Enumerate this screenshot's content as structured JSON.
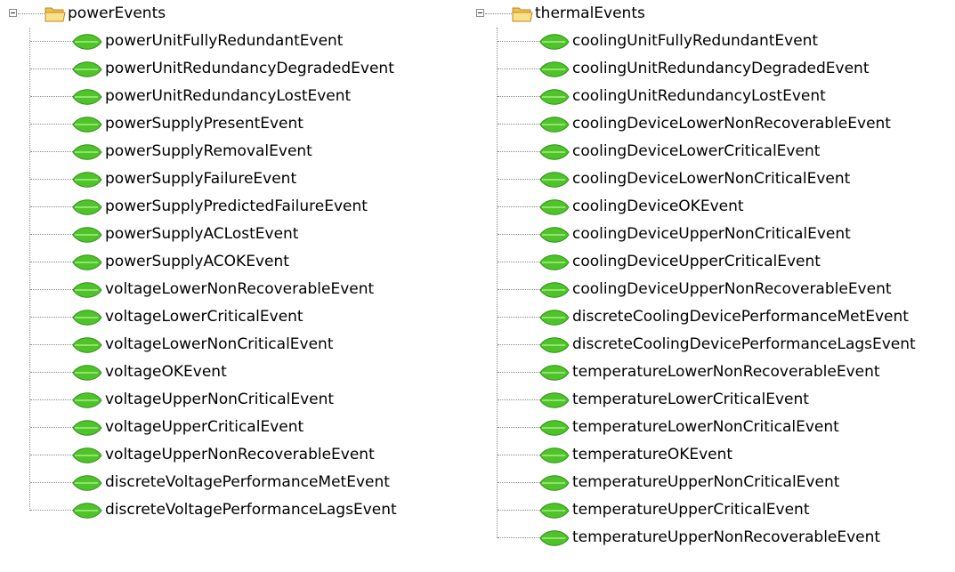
{
  "trees": [
    {
      "root": {
        "label": "powerEvents",
        "icon": "folder-icon",
        "expanded": true
      },
      "items": [
        "powerUnitFullyRedundantEvent",
        "powerUnitRedundancyDegradedEvent",
        "powerUnitRedundancyLostEvent",
        "powerSupplyPresentEvent",
        "powerSupplyRemovalEvent",
        "powerSupplyFailureEvent",
        "powerSupplyPredictedFailureEvent",
        "powerSupplyACLostEvent",
        "powerSupplyACOKEvent",
        "voltageLowerNonRecoverableEvent",
        "voltageLowerCriticalEvent",
        "voltageLowerNonCriticalEvent",
        "voltageOKEvent",
        "voltageUpperNonCriticalEvent",
        "voltageUpperCriticalEvent",
        "voltageUpperNonRecoverableEvent",
        "discreteVoltagePerformanceMetEvent",
        "discreteVoltagePerformanceLagsEvent"
      ]
    },
    {
      "root": {
        "label": "thermalEvents",
        "icon": "folder-icon",
        "expanded": true
      },
      "items": [
        "coolingUnitFullyRedundantEvent",
        "coolingUnitRedundancyDegradedEvent",
        "coolingUnitRedundancyLostEvent",
        "coolingDeviceLowerNonRecoverableEvent",
        "coolingDeviceLowerCriticalEvent",
        "coolingDeviceLowerNonCriticalEvent",
        "coolingDeviceOKEvent",
        "coolingDeviceUpperNonCriticalEvent",
        "coolingDeviceUpperCriticalEvent",
        "coolingDeviceUpperNonRecoverableEvent",
        "discreteCoolingDevicePerformanceMetEvent",
        "discreteCoolingDevicePerformanceLagsEvent",
        "temperatureLowerNonRecoverableEvent",
        "temperatureLowerCriticalEvent",
        "temperatureLowerNonCriticalEvent",
        "temperatureOKEvent",
        "temperatureUpperNonCriticalEvent",
        "temperatureUpperCriticalEvent",
        "temperatureUpperNonRecoverableEvent"
      ]
    }
  ],
  "leaf_icon": "leaf-event-icon",
  "colors": {
    "leaf": "#4fc42a",
    "folder": "#f5c242",
    "tree_line": "#8a8a8a"
  }
}
